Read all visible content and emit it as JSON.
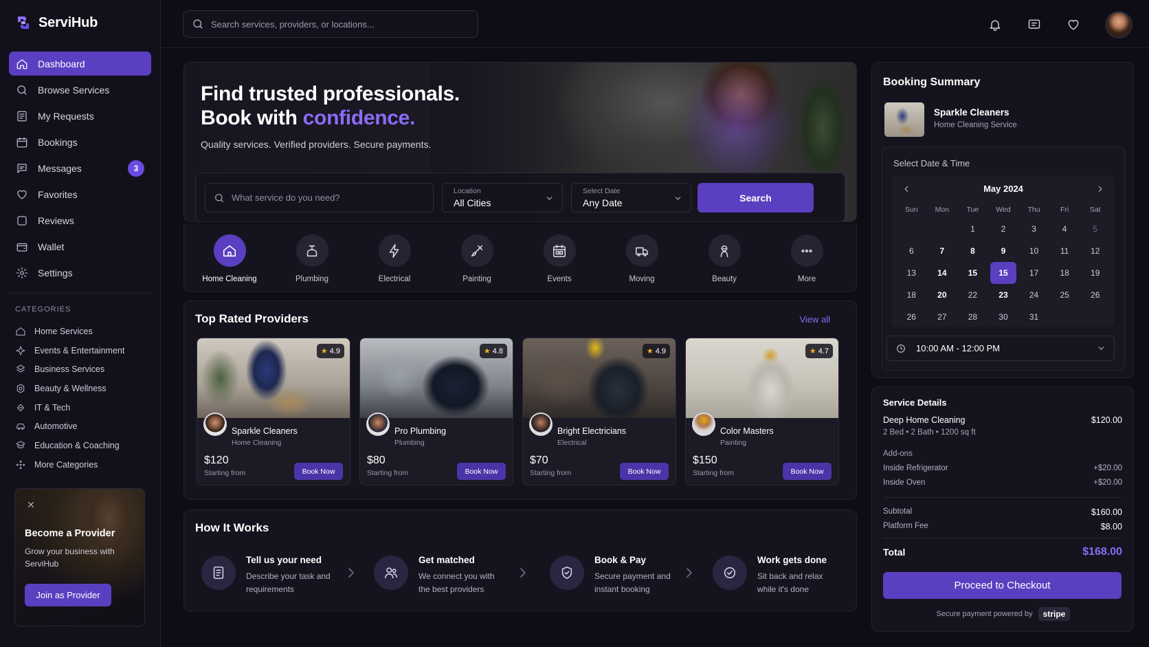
{
  "brand": {
    "name": "ServiHub"
  },
  "sidebar": {
    "nav": [
      {
        "label": "Dashboard",
        "icon": "home-icon"
      },
      {
        "label": "Browse Services",
        "icon": "search-icon"
      },
      {
        "label": "My Requests",
        "icon": "document-icon"
      },
      {
        "label": "Bookings",
        "icon": "calendar-icon"
      },
      {
        "label": "Messages",
        "icon": "message-icon",
        "badge": "3"
      },
      {
        "label": "Favorites",
        "icon": "heart-icon"
      },
      {
        "label": "Reviews",
        "icon": "star-outline-icon"
      },
      {
        "label": "Wallet",
        "icon": "wallet-icon"
      },
      {
        "label": "Settings",
        "icon": "gear-icon"
      }
    ],
    "categories_heading": "CATEGORIES",
    "categories": [
      {
        "label": "Home Services",
        "icon": "home-icon"
      },
      {
        "label": "Events & Entertainment",
        "icon": "sparkle-icon"
      },
      {
        "label": "Business Services",
        "icon": "briefcase-icon"
      },
      {
        "label": "Beauty & Wellness",
        "icon": "flower-icon"
      },
      {
        "label": "IT & Tech",
        "icon": "chip-icon"
      },
      {
        "label": "Automotive",
        "icon": "car-icon"
      },
      {
        "label": "Education & Coaching",
        "icon": "graduation-icon"
      },
      {
        "label": "More Categories",
        "icon": "dots-grid-icon"
      }
    ],
    "promo": {
      "title": "Become a Provider",
      "text": "Grow your business with ServiHub",
      "button": "Join as Provider"
    }
  },
  "topbar": {
    "search_placeholder": "Search services, providers, or locations...",
    "icons": [
      "bell-icon",
      "chat-icon",
      "heart-icon"
    ]
  },
  "hero": {
    "title_line1": "Find trusted professionals.",
    "title_line2_prefix": "Book with",
    "title_line2_accent": "confidence.",
    "subtitle": "Quality services. Verified providers. Secure payments.",
    "search_placeholder": "What service do you need?",
    "location_label": "Location",
    "location_value": "All Cities",
    "date_label": "Select Date",
    "date_value": "Any Date",
    "search_button": "Search"
  },
  "service_categories": [
    {
      "label": "Home Cleaning",
      "icon": "house-icon",
      "active": true
    },
    {
      "label": "Plumbing",
      "icon": "faucet-icon"
    },
    {
      "label": "Electrical",
      "icon": "lightning-icon"
    },
    {
      "label": "Painting",
      "icon": "brush-icon"
    },
    {
      "label": "Events",
      "icon": "calendar-icon"
    },
    {
      "label": "Moving",
      "icon": "truck-icon"
    },
    {
      "label": "Beauty",
      "icon": "beauty-icon"
    },
    {
      "label": "More",
      "icon": "more-icon"
    }
  ],
  "top_rated": {
    "title": "Top Rated Providers",
    "view_all": "View all",
    "providers": [
      {
        "name": "Sparkle Cleaners",
        "category": "Home Cleaning",
        "rating": "4.9",
        "price": "$120",
        "from": "Starting from",
        "button": "Book Now"
      },
      {
        "name": "Pro Plumbing",
        "category": "Plumbing",
        "rating": "4.8",
        "price": "$80",
        "from": "Starting from",
        "button": "Book Now"
      },
      {
        "name": "Bright Electricians",
        "category": "Electrical",
        "rating": "4.9",
        "price": "$70",
        "from": "Starting from",
        "button": "Book Now"
      },
      {
        "name": "Color Masters",
        "category": "Painting",
        "rating": "4.7",
        "price": "$150",
        "from": "Starting from",
        "button": "Book Now"
      }
    ]
  },
  "how_it_works": {
    "title": "How It Works",
    "steps": [
      {
        "title": "Tell us your need",
        "text": "Describe your task and requirements",
        "icon": "document-icon"
      },
      {
        "title": "Get matched",
        "text": "We connect you with the best providers",
        "icon": "users-icon"
      },
      {
        "title": "Book & Pay",
        "text": "Secure payment and instant booking",
        "icon": "shield-icon"
      },
      {
        "title": "Work gets done",
        "text": "Sit back and relax while it's done",
        "icon": "check-circle-icon"
      }
    ]
  },
  "booking": {
    "title": "Booking Summary",
    "provider": "Sparkle Cleaners",
    "service": "Home Cleaning Service",
    "select_label": "Select Date & Time",
    "month": "May 2024",
    "weekdays": [
      "Sun",
      "Mon",
      "Tue",
      "Wed",
      "Thu",
      "Fri",
      "Sat"
    ],
    "weeks": [
      [
        "",
        "",
        "1",
        "2",
        "3",
        "4",
        "5"
      ],
      [
        "6",
        "7",
        "8",
        "9",
        "10",
        "11",
        "12"
      ],
      [
        "13",
        "14",
        "15",
        "15",
        "17",
        "18",
        "19"
      ],
      [
        "18",
        "20",
        "22",
        "23",
        "24",
        "25",
        "26"
      ],
      [
        "26",
        "27",
        "28",
        "30",
        "31",
        "",
        ""
      ]
    ],
    "selected_day": "15",
    "time": "10:00 AM - 12:00 PM"
  },
  "details": {
    "title": "Service Details",
    "service_name": "Deep Home Cleaning",
    "service_price": "$120.00",
    "service_meta": "2 Bed • 2 Bath • 1200 sq ft",
    "addons_label": "Add-ons",
    "addons": [
      {
        "label": "Inside Refrigerator",
        "price": "+$20.00"
      },
      {
        "label": "Inside Oven",
        "price": "+$20.00"
      }
    ],
    "subtotal_label": "Subtotal",
    "subtotal": "$160.00",
    "fee_label": "Platform Fee",
    "fee": "$8.00",
    "total_label": "Total",
    "total": "$168.00",
    "checkout": "Proceed to Checkout",
    "secure_text": "Secure payment powered by",
    "stripe": "stripe"
  },
  "colors": {
    "accent": "#5a3fc0",
    "accent_text": "#8b6cf6",
    "background": "#0e0d16",
    "star": "#f2b01e"
  }
}
